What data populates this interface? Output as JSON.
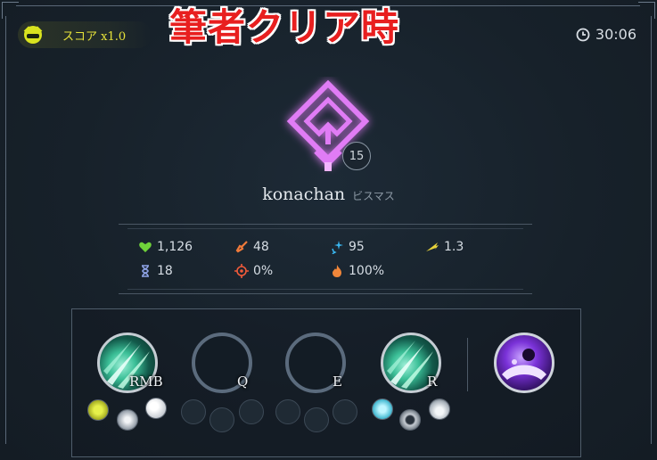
{
  "score": {
    "label": "スコア x1.0",
    "color": "#e6e23a"
  },
  "banner": {
    "text": "筆者クリア時",
    "color": "#e81f1f"
  },
  "timer": {
    "value": "30:06"
  },
  "player": {
    "name": "konachan",
    "tag": "ビスマス",
    "level": "15",
    "emblem_color": "#d86bf0"
  },
  "stats": [
    {
      "icon": "heart-icon",
      "value": "1,126",
      "color": "#6fd13a"
    },
    {
      "icon": "sword-icon",
      "value": "48",
      "color": "#f07a3a"
    },
    {
      "icon": "sparkle-icon",
      "value": "95",
      "color": "#3ab7f0"
    },
    {
      "icon": "wing-icon",
      "value": "1.3",
      "color": "#e6d23a"
    },
    {
      "icon": "hourglass-icon",
      "value": "18",
      "color": "#8ea3e6"
    },
    {
      "icon": "target-icon",
      "value": "0%",
      "color": "#f05a3a"
    },
    {
      "icon": "flame-icon",
      "value": "100%",
      "color": "#f0863a"
    }
  ],
  "abilities": [
    {
      "key": "RMB",
      "state": "skill"
    },
    {
      "key": "Q",
      "state": "empty"
    },
    {
      "key": "E",
      "state": "empty"
    },
    {
      "key": "R",
      "state": "skill"
    },
    {
      "key": "",
      "state": "ultimate"
    }
  ]
}
